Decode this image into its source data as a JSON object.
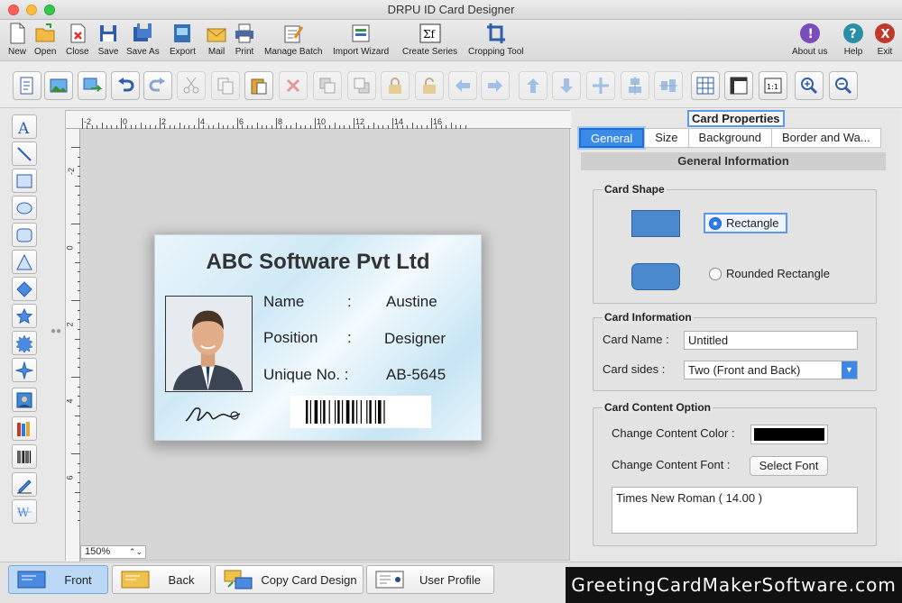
{
  "window": {
    "title": "DRPU ID Card Designer"
  },
  "main_toolbar": {
    "new": "New",
    "open": "Open",
    "close": "Close",
    "save": "Save",
    "save_as": "Save As",
    "export": "Export",
    "mail": "Mail",
    "print": "Print",
    "manage_batch": "Manage Batch",
    "import_wizard": "Import Wizard",
    "create_series": "Create Series",
    "cropping_tool": "Cropping Tool",
    "about_us": "About us",
    "help": "Help",
    "exit": "Exit"
  },
  "ruler": {
    "h_labels": [
      "-2",
      "0",
      "2",
      "4",
      "6",
      "8",
      "10",
      "12",
      "14",
      "16"
    ],
    "v_labels": [
      "-2",
      "0",
      "2",
      "4",
      "6"
    ]
  },
  "zoom": {
    "value": "150%"
  },
  "card": {
    "company": "ABC Software Pvt Ltd",
    "rows": [
      {
        "label": "Name",
        "sep": ":",
        "value": "Austine"
      },
      {
        "label": "Position",
        "sep": ":",
        "value": "Designer"
      },
      {
        "label": "Unique No. :",
        "sep": "",
        "value": "AB-5645"
      }
    ]
  },
  "props": {
    "title": "Card Properties",
    "tabs": [
      "General",
      "Size",
      "Background",
      "Border and Wa..."
    ],
    "section": "General Information",
    "card_shape": {
      "label": "Card Shape",
      "rectangle": "Rectangle",
      "rounded": "Rounded Rectangle",
      "selected": "rectangle",
      "shape_color": "#4b89cf"
    },
    "card_info": {
      "label": "Card Information",
      "name_label": "Card Name :",
      "name_value": "Untitled",
      "sides_label": "Card sides :",
      "sides_value": "Two (Front and Back)"
    },
    "content": {
      "label": "Card Content Option",
      "color_label": "Change Content Color :",
      "color_value": "#000000",
      "font_label": "Change Content Font :",
      "font_button": "Select Font",
      "font_value": "Times New Roman ( 14.00 )"
    }
  },
  "bottom": {
    "front": "Front",
    "back": "Back",
    "copy": "Copy Card Design",
    "profile": "User Profile",
    "brand": "GreetingCardMakerSoftware.com"
  },
  "colors": {
    "accent": "#3b8ae6"
  }
}
